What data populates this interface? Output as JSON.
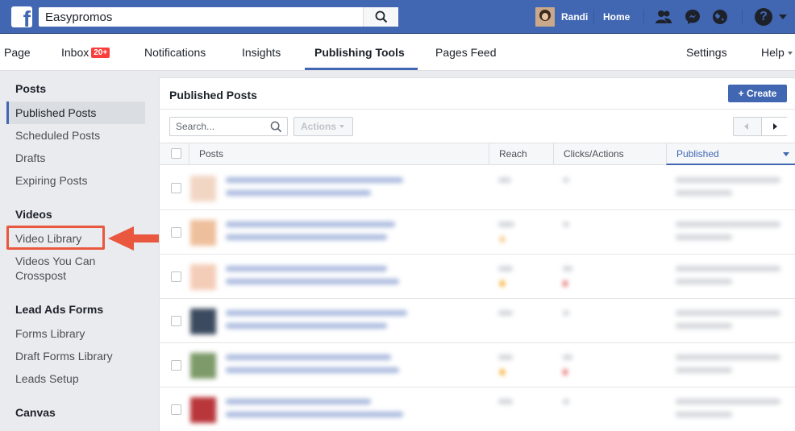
{
  "topbar": {
    "search_value": "Easypromos",
    "user_name": "Randi",
    "home_label": "Home",
    "icons": [
      "facebook-logo-icon",
      "search-icon",
      "friend-requests-icon",
      "messenger-icon",
      "globe-notifications-icon",
      "help-icon",
      "caret-down-icon"
    ]
  },
  "page_nav": {
    "items": [
      "Page",
      "Inbox",
      "Notifications",
      "Insights",
      "Publishing Tools",
      "Pages Feed",
      "Settings",
      "Help"
    ],
    "inbox_badge": "20+",
    "active": "Publishing Tools"
  },
  "sidebar": {
    "sections": [
      {
        "title": "Posts",
        "items": [
          "Published Posts",
          "Scheduled Posts",
          "Drafts",
          "Expiring Posts"
        ]
      },
      {
        "title": "Videos",
        "items": [
          "Video Library",
          "Videos You Can Crosspost"
        ]
      },
      {
        "title": "Lead Ads Forms",
        "items": [
          "Forms Library",
          "Draft Forms Library",
          "Leads Setup"
        ]
      },
      {
        "title": "Canvas",
        "items": []
      }
    ],
    "active_item": "Published Posts",
    "highlighted_item": "Video Library",
    "highlight_color": "#e9573f"
  },
  "main": {
    "title": "Published Posts",
    "create_label": "Create",
    "search_placeholder": "Search...",
    "actions_label": "Actions",
    "columns": [
      "Posts",
      "Reach",
      "Clicks/Actions",
      "Published"
    ],
    "sorted_column": "Published"
  },
  "colors": {
    "brand": "#4267b2",
    "badge": "#fa3e3e"
  }
}
